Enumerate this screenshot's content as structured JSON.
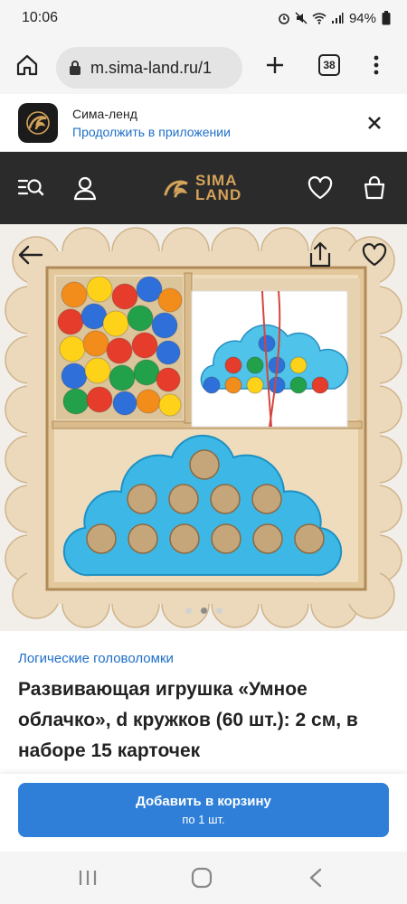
{
  "status": {
    "time": "10:06",
    "battery": "94%"
  },
  "browser": {
    "url": "m.sima-land.ru/1",
    "tabs_count": "38"
  },
  "app_banner": {
    "name": "Сима-ленд",
    "continue": "Продолжить в приложении"
  },
  "header": {
    "logo_line1": "SIMA",
    "logo_line2": "LAND"
  },
  "product": {
    "category": "Логические головоломки",
    "title": "Развивающая игрушка «Умное облачко», d кружков (60 шт.): 2 см, в наборе 15 карточек",
    "gallery": {
      "count": 3,
      "active": 2
    }
  },
  "cart": {
    "label": "Добавить в корзину",
    "sub": "по 1 шт."
  },
  "colors": {
    "accent": "#2f7fd8",
    "link": "#1f6fc8",
    "header_bg": "#2b2b2b",
    "logo_gold": "#d4a35a"
  },
  "icons": [
    "home-icon",
    "lock-icon",
    "plus-icon",
    "tabs-icon",
    "more-icon",
    "app-logo-icon",
    "close-icon",
    "catalog-search-icon",
    "user-icon",
    "heart-icon",
    "cart-icon",
    "back-arrow-icon",
    "share-icon",
    "favorite-icon",
    "recents-icon",
    "home-nav-icon",
    "back-nav-icon"
  ]
}
